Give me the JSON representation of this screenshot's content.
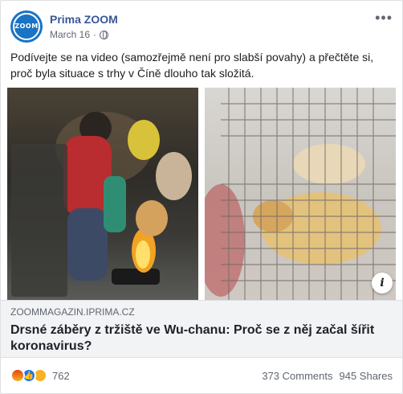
{
  "post": {
    "page_name": "Prima ZOOM",
    "date": "March 16",
    "privacy_icon": "globe-icon",
    "avatar_logo": "ZOOM",
    "text": "Podívejte se na video (samozřejmě není pro slabší povahy) a přečtěte si, proč byla situace s trhy v Číně dlouho tak složitá."
  },
  "link": {
    "domain": "ZOOMMAGAZIN.IPRIMA.CZ",
    "title": "Drsné záběry z tržiště ve Wu-chanu: Proč se z něj začal šířit koronavirus?",
    "info_icon": "i"
  },
  "footer": {
    "reactions": [
      "angry-react-icon",
      "like-react-icon",
      "sad-react-icon"
    ],
    "reaction_count": "762",
    "comments": "373 Comments",
    "shares": "945 Shares"
  },
  "colors": {
    "page_name": "#385898",
    "avatar_bg": "#1a73c4",
    "link_bg": "#f2f3f5"
  }
}
